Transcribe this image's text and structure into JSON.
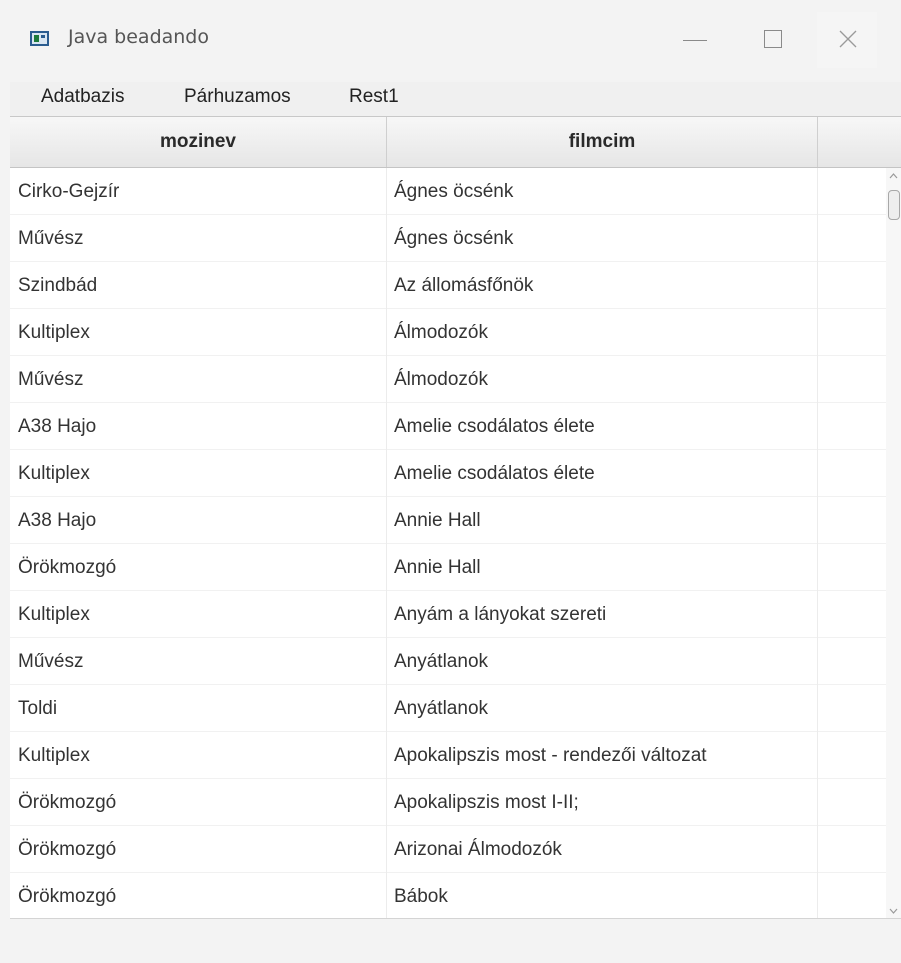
{
  "window": {
    "title": "Java beadando"
  },
  "menu": {
    "items": [
      "Adatbazis",
      "Párhuzamos",
      "Rest1"
    ]
  },
  "table": {
    "columns": [
      "mozinev",
      "filmcim",
      ""
    ],
    "rows": [
      [
        "Cirko-Gejzír",
        "Ágnes öcsénk"
      ],
      [
        "Művész",
        "Ágnes öcsénk"
      ],
      [
        "Szindbád",
        "Az állomásfőnök"
      ],
      [
        "Kultiplex",
        "Álmodozók"
      ],
      [
        "Művész",
        "Álmodozók"
      ],
      [
        "A38 Hajo",
        "Amelie csodálatos élete"
      ],
      [
        "Kultiplex",
        "Amelie csodálatos élete"
      ],
      [
        "A38 Hajo",
        "Annie Hall"
      ],
      [
        "Örökmozgó",
        "Annie Hall"
      ],
      [
        "Kultiplex",
        "Anyám a lányokat szereti"
      ],
      [
        "Művész",
        "Anyátlanok"
      ],
      [
        "Toldi",
        "Anyátlanok"
      ],
      [
        "Kultiplex",
        "Apokalipszis most - rendezői változat"
      ],
      [
        "Örökmozgó",
        "Apokalipszis most I-II;"
      ],
      [
        "Örökmozgó",
        "Arizonai Álmodozók"
      ],
      [
        "Örökmozgó",
        "Bábok"
      ]
    ]
  },
  "icons": {
    "app": "java-app-icon",
    "minimize": "minimize-icon",
    "maximize": "maximize-icon",
    "close": "close-icon",
    "scroll_up": "chevron-up-icon",
    "scroll_down": "chevron-down-icon"
  }
}
